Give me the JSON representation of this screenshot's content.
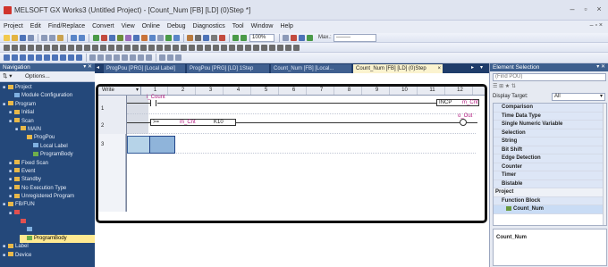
{
  "window": {
    "title": "MELSOFT GX Works3 (Untitled Project) - [Count_Num [FB] [LD] (0)Step *]",
    "min_label": "–",
    "max_label": "▫",
    "close_label": "×",
    "mdi_controls": "– ▫ ×"
  },
  "menu": [
    "Project",
    "Edit",
    "Find/Replace",
    "Convert",
    "View",
    "Online",
    "Debug",
    "Diagnostics",
    "Tool",
    "Window",
    "Help"
  ],
  "toolbar": {
    "zoom": "100%",
    "max_label": "Max.:",
    "max_value": "--------"
  },
  "navigation": {
    "title": "Navigation",
    "options_label": "Options...",
    "tree": [
      {
        "label": "Project",
        "level": 0,
        "icon": "folder"
      },
      {
        "label": "Module Configuration",
        "level": 1,
        "icon": "module"
      },
      {
        "label": "Program",
        "level": 0,
        "icon": "folder"
      },
      {
        "label": "Initial",
        "level": 1,
        "icon": "folder"
      },
      {
        "label": "Scan",
        "level": 1,
        "icon": "folder"
      },
      {
        "label": "MAIN",
        "level": 2,
        "icon": "folder"
      },
      {
        "label": "ProgPou",
        "level": 3,
        "icon": "folder"
      },
      {
        "label": "Local Label",
        "level": 4,
        "icon": "label"
      },
      {
        "label": "ProgramBody",
        "level": 4,
        "icon": "body"
      },
      {
        "label": "Fixed Scan",
        "level": 1,
        "icon": "folder"
      },
      {
        "label": "Event",
        "level": 1,
        "icon": "folder"
      },
      {
        "label": "Standby",
        "level": 1,
        "icon": "folder"
      },
      {
        "label": "No Execution Type",
        "level": 1,
        "icon": "folder"
      },
      {
        "label": "Unregistered Program",
        "level": 1,
        "icon": "folder"
      },
      {
        "label": "FB/FUN",
        "level": 0,
        "icon": "folder"
      },
      {
        "label": "",
        "level": 1,
        "icon": "folder-red"
      },
      {
        "label": "",
        "level": 2,
        "icon": "fb-red"
      },
      {
        "label": "",
        "level": 3,
        "icon": "label"
      },
      {
        "label": "ProgramBody",
        "level": 3,
        "icon": "body",
        "selected": true
      },
      {
        "label": "Label",
        "level": 0,
        "icon": "folder"
      },
      {
        "label": "Device",
        "level": 0,
        "icon": "folder"
      }
    ]
  },
  "tabs": [
    {
      "label": "ProgPou [PRG] [Local Label]"
    },
    {
      "label": "ProgPou [PRG] [LD] 1Step"
    },
    {
      "label": "Count_Num [FB] [Local..."
    },
    {
      "label": "Count_Num [FB] [LD] (0)Step",
      "active": true
    }
  ],
  "ladder": {
    "mode": "Write",
    "columns": [
      "1",
      "2",
      "3",
      "4",
      "5",
      "6",
      "7",
      "8",
      "9",
      "10",
      "11",
      "12"
    ],
    "rows": [
      "1",
      "2",
      "3"
    ],
    "row1": {
      "contact_device": "i_Count",
      "inst": "INCP",
      "inst_device": "m_Cnt"
    },
    "row2": {
      "op": ">=",
      "op_dev1": "m_Cnt",
      "op_dev2": "K10",
      "coil_device": "o_Out"
    }
  },
  "element_selection": {
    "title": "Element Selection",
    "find_placeholder": "(Find POU)",
    "display_target_label": "Display Target:",
    "display_target_value": "All",
    "items": [
      {
        "label": "Comparison",
        "type": "item"
      },
      {
        "label": "Time Data Type",
        "type": "item"
      },
      {
        "label": "Single Numeric Variable",
        "type": "item"
      },
      {
        "label": "Selection",
        "type": "item"
      },
      {
        "label": "String",
        "type": "item"
      },
      {
        "label": "Bit Shift",
        "type": "item"
      },
      {
        "label": "Edge Detection",
        "type": "item"
      },
      {
        "label": "Counter",
        "type": "item"
      },
      {
        "label": "Timer",
        "type": "item"
      },
      {
        "label": "Bistable",
        "type": "item"
      },
      {
        "label": "Project",
        "type": "section"
      },
      {
        "label": "Function Block",
        "type": "item"
      },
      {
        "label": "Count_Num",
        "type": "selected"
      }
    ],
    "selected_name": "Count_Num"
  }
}
